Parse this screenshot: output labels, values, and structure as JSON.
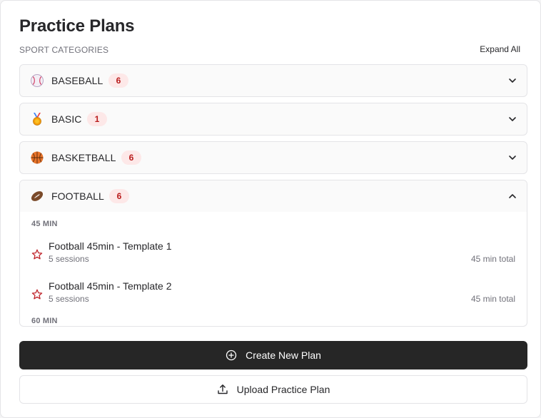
{
  "header": {
    "title": "Practice Plans",
    "subtitle": "SPORT CATEGORIES",
    "expand_all_label": "Expand All"
  },
  "categories": [
    {
      "name": "BASEBALL",
      "count": "6",
      "icon": "baseball-icon",
      "expanded": false
    },
    {
      "name": "BASIC",
      "count": "1",
      "icon": "medal-icon",
      "expanded": false
    },
    {
      "name": "BASKETBALL",
      "count": "6",
      "icon": "basketball-icon",
      "expanded": false
    },
    {
      "name": "FOOTBALL",
      "count": "6",
      "icon": "football-icon",
      "expanded": true,
      "groups": [
        {
          "label": "45 MIN",
          "plans": [
            {
              "name": "Football 45min - Template 1",
              "sessions": "5 sessions",
              "total": "45 min total"
            },
            {
              "name": "Football 45min - Template 2",
              "sessions": "5 sessions",
              "total": "45 min total"
            }
          ]
        },
        {
          "label": "60 MIN",
          "plans": []
        }
      ]
    }
  ],
  "actions": {
    "create_label": "Create New Plan",
    "upload_label": "Upload Practice Plan"
  },
  "colors": {
    "badge_bg": "#fde8e8",
    "badge_text": "#b91c1c",
    "star": "#c0262d",
    "primary_button": "#262626"
  }
}
